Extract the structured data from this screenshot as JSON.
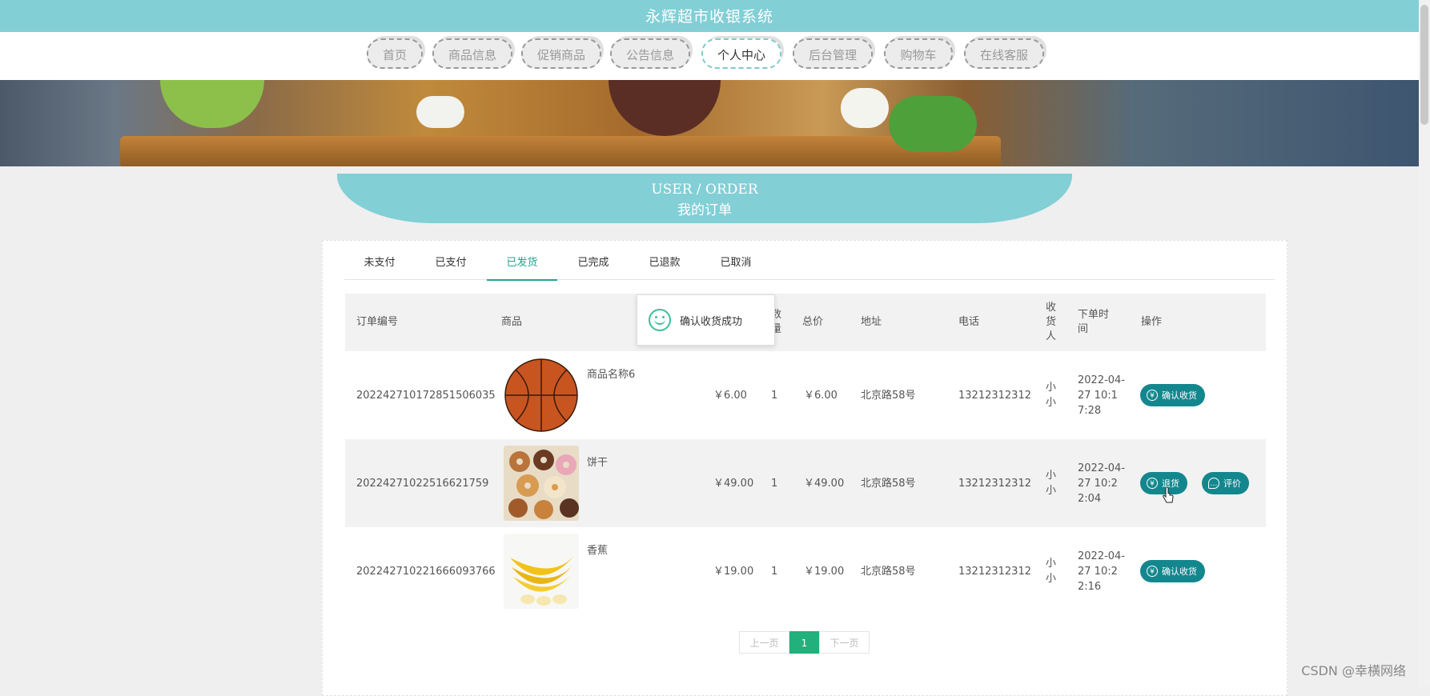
{
  "app": {
    "title": "永辉超市收银系统"
  },
  "nav": {
    "items": [
      {
        "label": "首页"
      },
      {
        "label": "商品信息"
      },
      {
        "label": "促销商品"
      },
      {
        "label": "公告信息"
      },
      {
        "label": "个人中心",
        "active": true
      },
      {
        "label": "后台管理"
      },
      {
        "label": "购物车"
      },
      {
        "label": "在线客服"
      }
    ]
  },
  "section": {
    "title_en": "USER / ORDER",
    "title_zh": "我的订单"
  },
  "tabs": [
    {
      "label": "未支付"
    },
    {
      "label": "已支付"
    },
    {
      "label": "已发货",
      "active": true
    },
    {
      "label": "已完成"
    },
    {
      "label": "已退款"
    },
    {
      "label": "已取消"
    }
  ],
  "table": {
    "headers": {
      "order_no": "订单编号",
      "product": "商品",
      "qty": "数量",
      "total": "总价",
      "address": "地址",
      "phone": "电话",
      "receiver": "收货人",
      "order_time": "下单时间",
      "action": "操作"
    },
    "rows": [
      {
        "order_no": "20224271017285150​6035",
        "product_name": "商品名称6",
        "product_image": "basketball",
        "price": "￥6.00",
        "qty": "1",
        "total": "￥6.00",
        "address": "北京路58号",
        "phone": "13212312312",
        "receiver": "小小",
        "order_time": "2022-04-27 10:17:28",
        "actions": [
          {
            "label": "确认收货",
            "icon": "yen-icon"
          }
        ]
      },
      {
        "order_no": "20224271022516621759",
        "product_name": "饼干",
        "product_image": "donuts",
        "price": "￥49.00",
        "qty": "1",
        "total": "￥49.00",
        "address": "北京路58号",
        "phone": "13212312312",
        "receiver": "小小",
        "order_time": "2022-04-27 10:22:04",
        "actions": [
          {
            "label": "退货",
            "icon": "yen-icon"
          },
          {
            "label": "评价",
            "icon": "comment-icon"
          }
        ]
      },
      {
        "order_no": "20224271022166609376​6",
        "product_name": "香蕉",
        "product_image": "bananas",
        "price": "￥19.00",
        "qty": "1",
        "total": "￥19.00",
        "address": "北京路58号",
        "phone": "13212312312",
        "receiver": "小小",
        "order_time": "2022-04-27 10:22:16",
        "actions": [
          {
            "label": "确认收货",
            "icon": "yen-icon"
          }
        ]
      }
    ]
  },
  "toast": {
    "message": "确认收货成功",
    "icon": "smile-icon"
  },
  "pager": {
    "prev": "上一页",
    "current": "1",
    "next": "下一页"
  },
  "watermark": "CSDN @幸横网络",
  "colors": {
    "header": "#82cfd6",
    "accent": "#14878e",
    "tab_active": "#22a38f",
    "page_current": "#22b07d"
  }
}
